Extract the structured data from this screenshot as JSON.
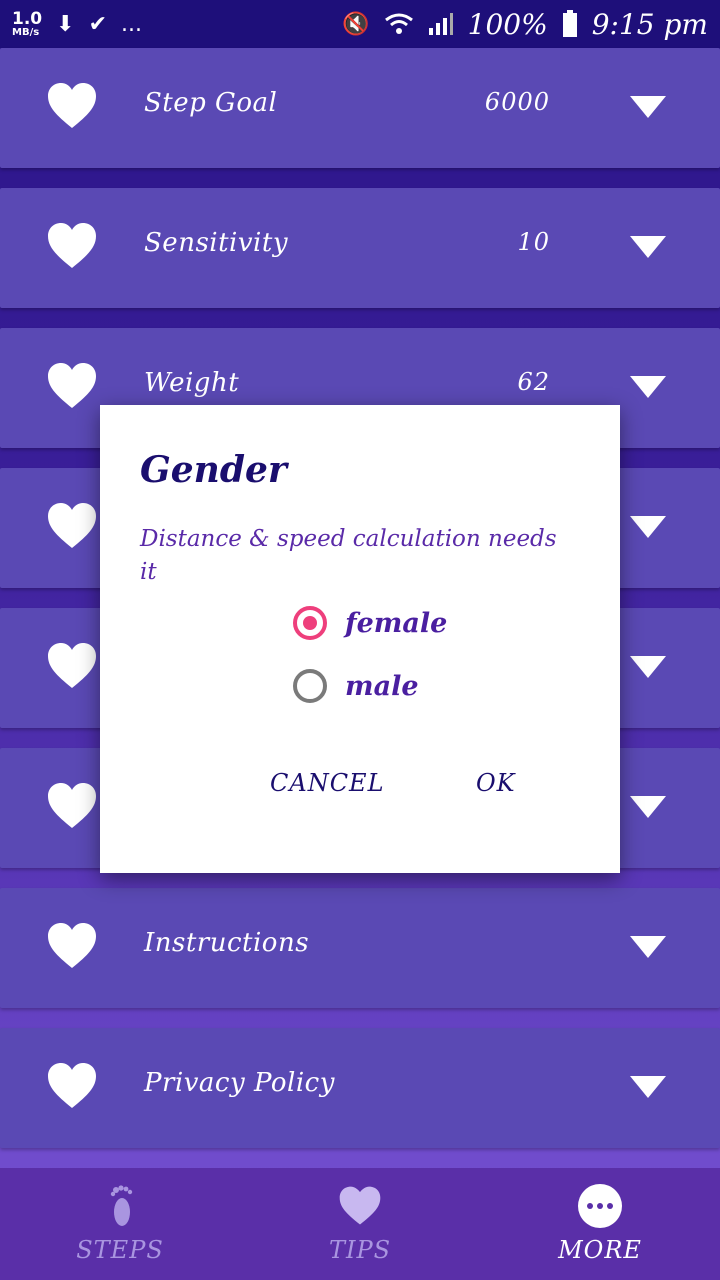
{
  "status_bar": {
    "speed_value": "1.0",
    "speed_unit": "MB/s",
    "more": "...",
    "battery": "100%",
    "time": "9:15 pm"
  },
  "settings": [
    {
      "label": "Step Goal",
      "value": "6000"
    },
    {
      "label": "Sensitivity",
      "value": "10"
    },
    {
      "label": "Weight",
      "value": "62"
    },
    {
      "label": "",
      "value": ""
    },
    {
      "label": "",
      "value": ""
    },
    {
      "label": "",
      "value": ""
    },
    {
      "label": "Instructions",
      "value": ""
    },
    {
      "label": "Privacy Policy",
      "value": ""
    }
  ],
  "dialog": {
    "title": "Gender",
    "message": "Distance & speed calculation needs it",
    "options": [
      {
        "label": "female",
        "selected": true
      },
      {
        "label": "male",
        "selected": false
      }
    ],
    "cancel": "CANCEL",
    "ok": "OK"
  },
  "bottom_nav": [
    {
      "label": "STEPS",
      "icon": "footprint-icon",
      "active": false
    },
    {
      "label": "TIPS",
      "icon": "heart-icon",
      "active": false
    },
    {
      "label": "MORE",
      "icon": "more-icon",
      "active": true
    }
  ],
  "colors": {
    "row_bg": "#5a49b4",
    "radio_selected": "#ee3f7c",
    "dialog_title": "#1a0e6e",
    "nav_bg": "#5a2fa8"
  }
}
